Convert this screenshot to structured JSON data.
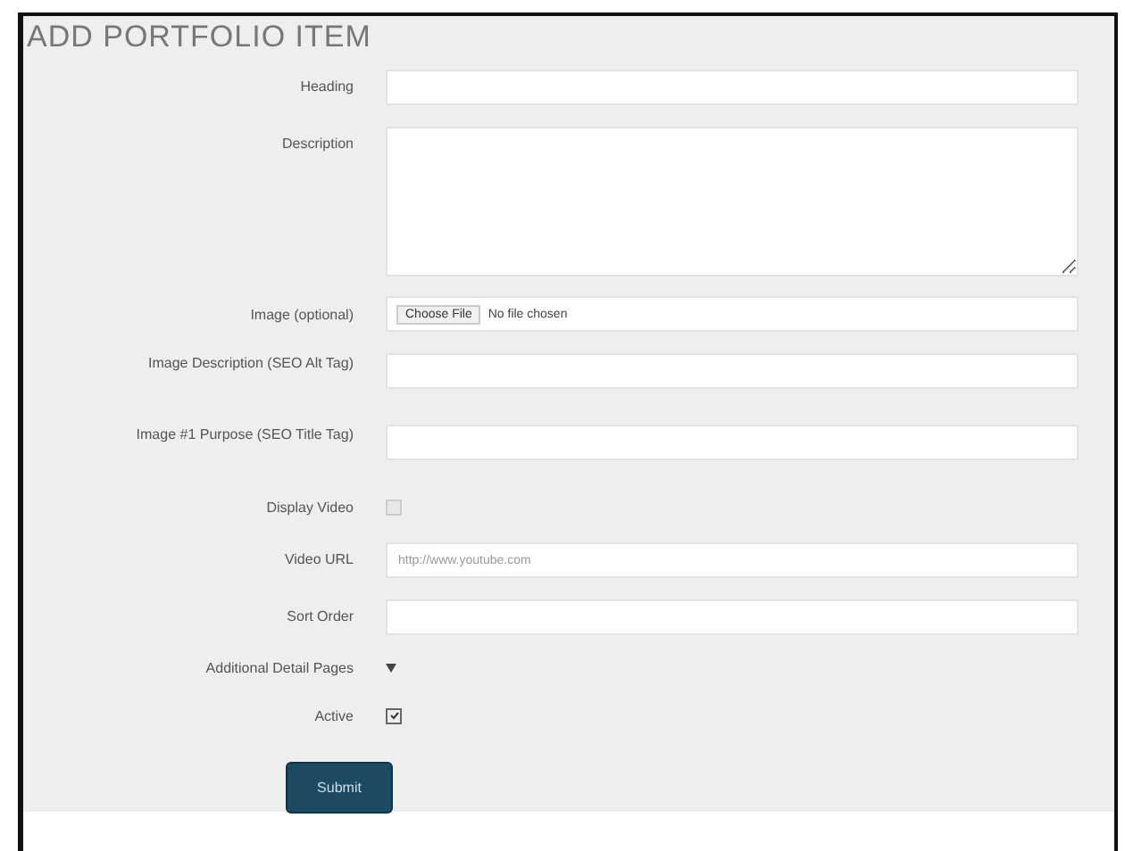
{
  "title": "ADD PORTFOLIO ITEM",
  "fields": [
    {
      "kind": "text",
      "label": "Heading"
    },
    {
      "kind": "textarea",
      "label": "Description"
    },
    {
      "kind": "file",
      "label": "Image (optional)",
      "button": "Choose File",
      "status": "No file chosen"
    },
    {
      "kind": "text",
      "label": "Image Description (SEO Alt Tag)"
    },
    {
      "kind": "text",
      "label": "Image #1 Purpose (SEO Title Tag)"
    },
    {
      "kind": "checkbox",
      "label": "Display Video",
      "checked": false
    },
    {
      "kind": "text",
      "label": "Video URL",
      "placeholder": "http://www.youtube.com"
    },
    {
      "kind": "text",
      "label": "Sort Order"
    },
    {
      "kind": "expander",
      "label": "Additional Detail Pages",
      "expanded": false
    },
    {
      "kind": "checkbox",
      "label": "Active",
      "checked": true
    }
  ],
  "submit": "Submit"
}
